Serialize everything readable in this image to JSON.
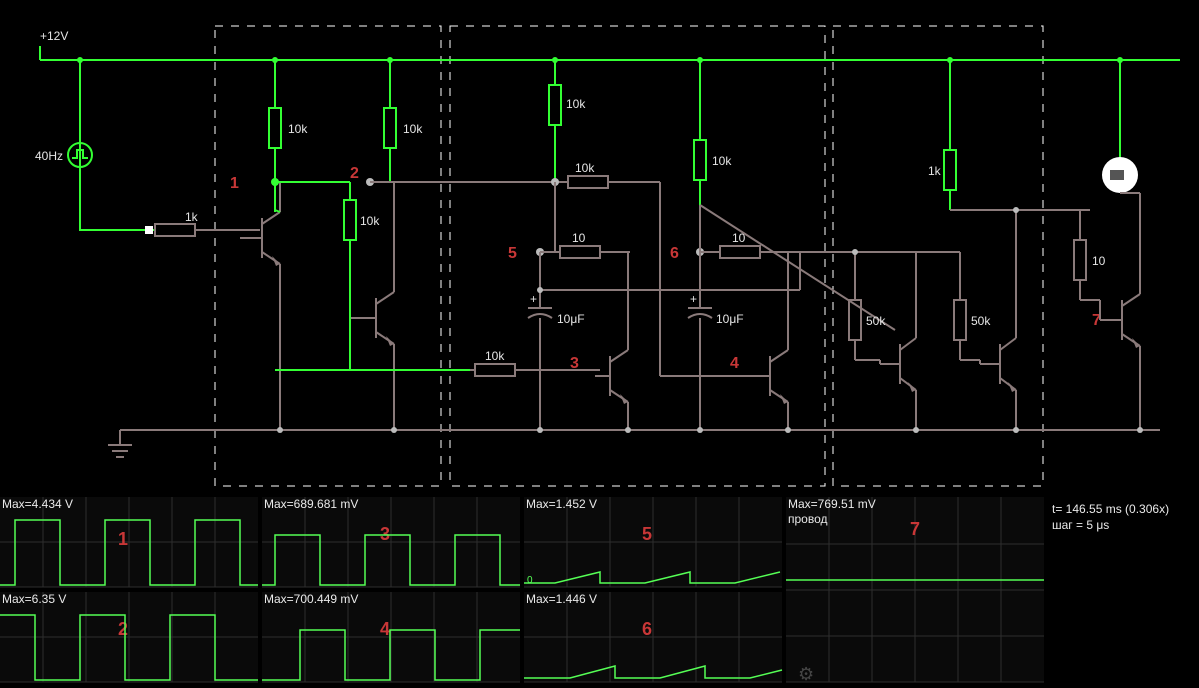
{
  "supply_label": "+12V",
  "source_label": "40Hz",
  "components": {
    "r_in": "1k",
    "r1": "10k",
    "r2": "10k",
    "r1a": "10k",
    "r3": "10k",
    "r4": "10k",
    "r5_10": "10",
    "r6_10": "10",
    "r8_10k": "10k",
    "r_top10k": "10k",
    "r_50k_a": "50k",
    "r_50k_b": "50k",
    "r_out1k": "1k",
    "r_out10": "10",
    "c5": "10μF",
    "c6": "10μF"
  },
  "node_numbers": [
    "1",
    "2",
    "3",
    "4",
    "5",
    "6",
    "7"
  ],
  "scopes": [
    {
      "label": "Max=4.434 V",
      "num": "1"
    },
    {
      "label": "Max=6.35 V",
      "num": "2"
    },
    {
      "label": "Max=689.681 mV",
      "num": "3"
    },
    {
      "label": "Max=700.449 mV",
      "num": "4"
    },
    {
      "label": "Max=1.452 V",
      "num": "5"
    },
    {
      "label": "Max=1.446 V",
      "num": "6"
    },
    {
      "label": "Max=769.51 mV",
      "num": "7",
      "sub": "провод"
    }
  ],
  "sim": {
    "time": "t= 146.55 ms (0.306x)",
    "step": "шаг = 5 μs"
  }
}
